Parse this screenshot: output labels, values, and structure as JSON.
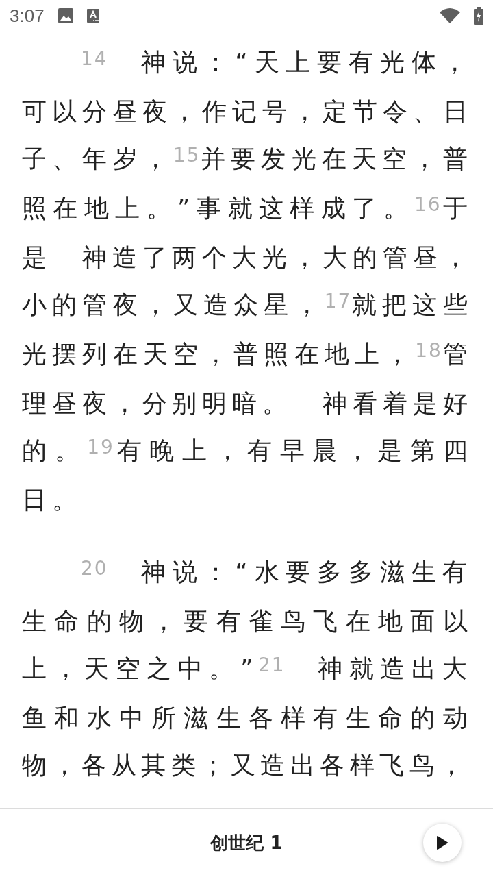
{
  "status_bar": {
    "time": "3:07"
  },
  "paragraphs": [
    "$^{14}$　神说：“天上要有光体，可以分昼夜，作记号，定节令、日子、年岁，$^{15}$并要发光在天空，普照在地上。”事就这样成了。$^{16}$于是　神造了两个大光，大的管昼，小的管夜，又造众星，$^{17}$就把这些光摆列在天空，普照在地上，$^{18}$管理昼夜，分别明暗。　神看着是好的。$^{19}$有晚上，有早晨，是第四日。",
    "$^{20}$　神说：“水要多多滋生有生命的物，要有雀鸟飞在地面以上，天空之中。”$^{21}$　神就造出大鱼和水中所滋生各样有生命的动物，各从其类；又造出各样飞鸟，"
  ],
  "bottom_bar": {
    "chapter_title": "创世纪 1"
  }
}
